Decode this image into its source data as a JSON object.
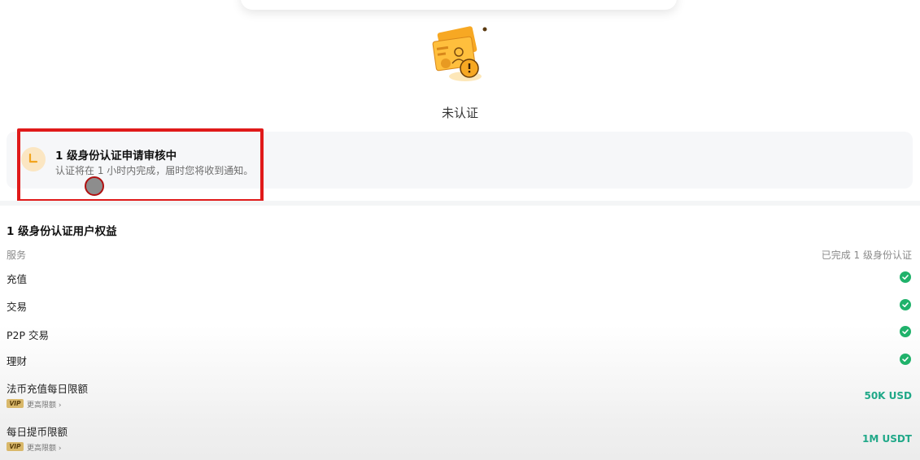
{
  "status": {
    "title": "未认证"
  },
  "pending": {
    "title": "1 级身份认证申请审核中",
    "subtitle": "认证将在 1 小时内完成，届时您将收到通知。"
  },
  "benefits": {
    "title": "1 级身份认证用户权益",
    "col_service": "服务",
    "col_status": "已完成 1 级身份认证",
    "rows": [
      {
        "label": "充值",
        "icon": "check-icon"
      },
      {
        "label": "交易",
        "icon": "check-icon"
      },
      {
        "label": "P2P 交易",
        "icon": "check-icon"
      },
      {
        "label": "理财",
        "icon": "check-icon"
      }
    ],
    "limits": [
      {
        "label": "法币充值每日限额",
        "badge": "VIP",
        "more": "更高限额",
        "value": "50K USD"
      },
      {
        "label": "每日提币限额",
        "badge": "VIP",
        "more": "更高限额",
        "value": "1M USDT"
      }
    ]
  },
  "colors": {
    "accent_green": "#20b26b",
    "highlight_red": "#e01a1a",
    "vip_gold": "#d9b86a"
  }
}
